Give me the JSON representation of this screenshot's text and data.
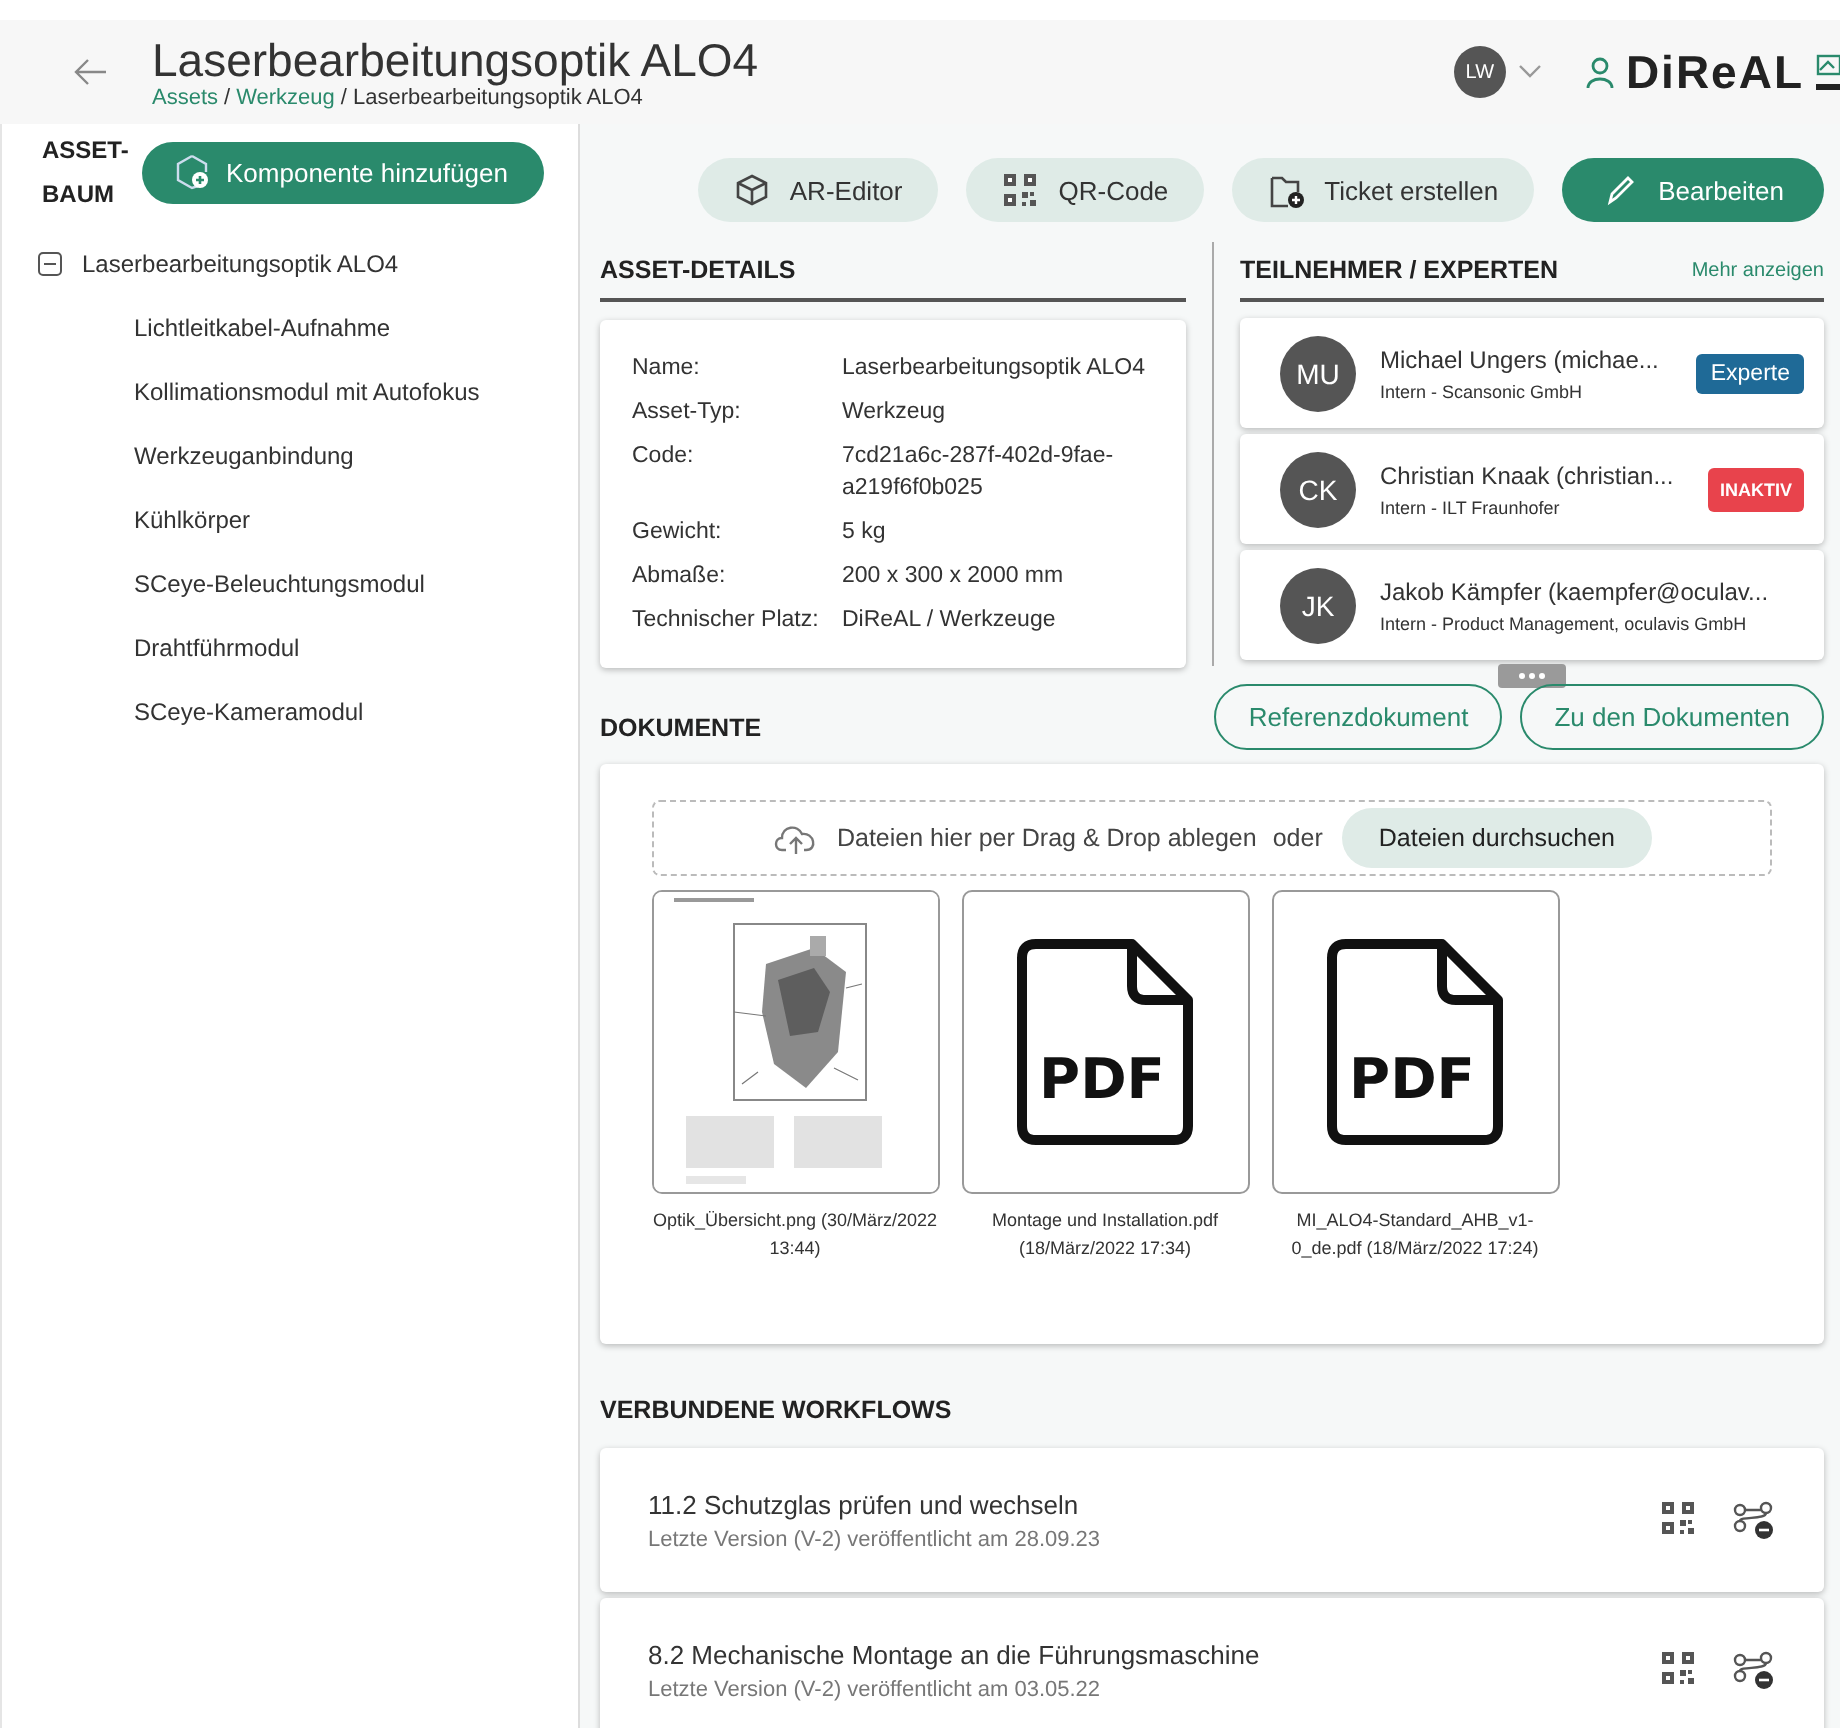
{
  "header": {
    "title": "Laserbearbeitungsoptik ALO4",
    "breadcrumb": {
      "separator": "/",
      "items": [
        {
          "label": "Assets",
          "link": true
        },
        {
          "label": "Werkzeug",
          "link": true
        },
        {
          "label": "Laserbearbeitungsoptik ALO4",
          "link": false
        }
      ]
    },
    "user": {
      "initials": "LW"
    },
    "logo": "DiReAL"
  },
  "sidebar": {
    "title": "ASSET-BAUM",
    "add_button": "Komponente hinzufügen",
    "tree": [
      {
        "label": "Laserbearbeitungsoptik ALO4",
        "expanded": true,
        "children": [
          {
            "label": "Lichtleitkabel-Aufnahme"
          },
          {
            "label": "Kollimationsmodul mit Autofokus"
          },
          {
            "label": "Werkzeuganbindung"
          },
          {
            "label": "Kühlkörper"
          },
          {
            "label": "SCeye-Beleuchtungsmodul"
          },
          {
            "label": "Drahtführmodul"
          },
          {
            "label": "SCeye-Kameramodul"
          }
        ]
      }
    ]
  },
  "toolbar": [
    {
      "label": "AR-Editor",
      "kind": "secondary"
    },
    {
      "label": "QR-Code",
      "kind": "secondary"
    },
    {
      "label": "Ticket erstellen",
      "kind": "secondary"
    },
    {
      "label": "Bearbeiten",
      "kind": "primary"
    }
  ],
  "asset_details": {
    "title": "ASSET-DETAILS",
    "fields": [
      {
        "label": "Name:",
        "value": "Laserbearbeitungsoptik ALO4"
      },
      {
        "label": "Asset-Typ:",
        "value": "Werkzeug"
      },
      {
        "label": "Code:",
        "value": "7cd21a6c-287f-402d-9fae-a219f6f0b025"
      },
      {
        "label": "Gewicht:",
        "value": "5 kg"
      },
      {
        "label": "Abmaße:",
        "value": "200 x 300 x 2000 mm"
      },
      {
        "label": "Technischer Platz:",
        "value": "DiReAL / Werkzeuge"
      }
    ]
  },
  "participants": {
    "title": "TEILNEHMER / EXPERTEN",
    "more_link": "Mehr anzeigen",
    "people": [
      {
        "initials": "MU",
        "name": "Michael Ungers (michae...",
        "org": "Intern - Scansonic GmbH",
        "badge": {
          "label": "Experte",
          "kind": "expert"
        }
      },
      {
        "initials": "CK",
        "name": "Christian Knaak (christian...",
        "org": "Intern - ILT Fraunhofer",
        "badge": {
          "label": "INAKTIV",
          "kind": "inactive"
        }
      },
      {
        "initials": "JK",
        "name": "Jakob Kämpfer (kaempfer@oculav...",
        "org": "Intern - Product Management, oculavis GmbH"
      }
    ]
  },
  "documents": {
    "title": "DOKUMENTE",
    "buttons": [
      "Referenzdokument",
      "Zu den Dokumenten"
    ],
    "dropzone": {
      "text": "Dateien hier per Drag & Drop ablegen",
      "separator": "oder",
      "button": "Dateien durchsuchen"
    },
    "files": [
      {
        "caption": "Optik_Übersicht.png (30/März/2022 13:44)"
      },
      {
        "kind": "pdf",
        "type_label": "PDF",
        "caption": "Montage und Installation.pdf (18/März/2022 17:34)"
      },
      {
        "kind": "pdf",
        "type_label": "PDF",
        "caption": "MI_ALO4-Standard_AHB_v1-0_de.pdf (18/März/2022 17:24)"
      }
    ]
  },
  "workflows": {
    "title": "VERBUNDENE WORKFLOWS",
    "items": [
      {
        "title": "11.2 Schutzglas prüfen und wechseln",
        "subtitle": "Letzte Version (V-2) veröffentlicht am 28.09.23"
      },
      {
        "title": "8.2 Mechanische Montage an die Führungsmaschine",
        "subtitle": "Letzte Version (V-2) veröffentlicht am 03.05.22"
      }
    ]
  }
}
